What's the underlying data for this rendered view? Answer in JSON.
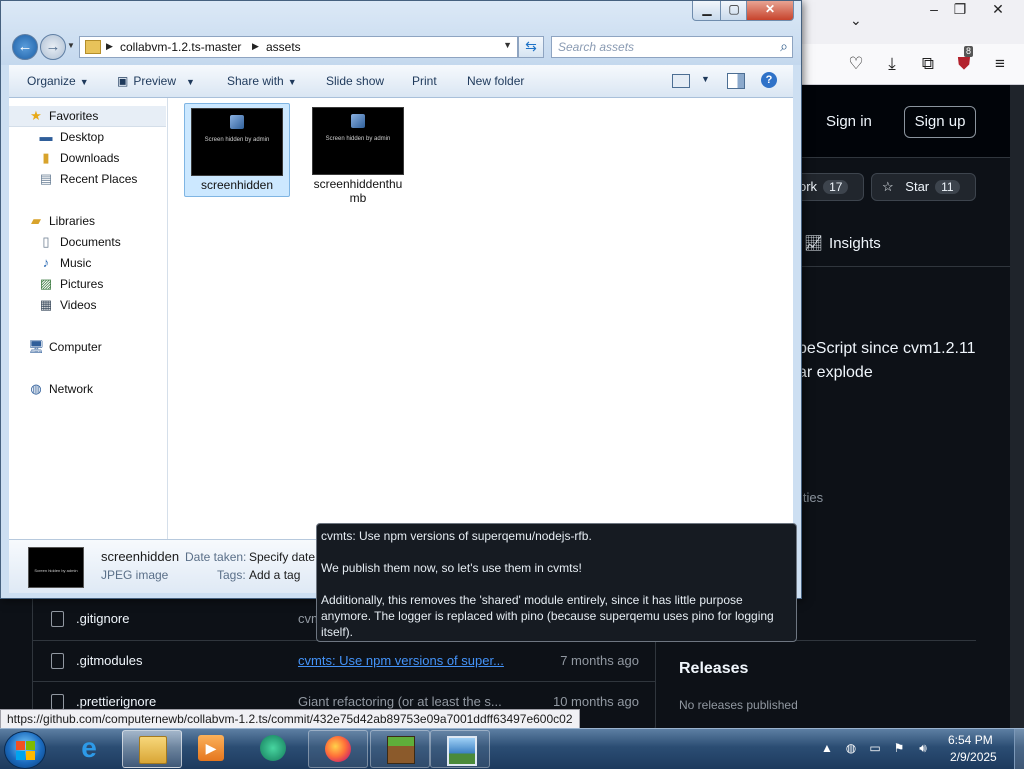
{
  "browser": {
    "header": {
      "sign_in": "Sign in",
      "sign_up": "Sign up"
    },
    "repo_actions": {
      "fork_label": "Fork",
      "fork_visible": "ork",
      "fork_count": "17",
      "star_label": "Star",
      "star_count": "11"
    },
    "tabs": {
      "insights": "Insights"
    },
    "about": {
      "line1": "peScript since cvm1.2.11",
      "line2": "ar explode",
      "activity": "ities"
    },
    "files": [
      {
        "name": ".gitignore",
        "message": "cvm",
        "date": "",
        "message_link": false
      },
      {
        "name": ".gitmodules",
        "message": "cvmts: Use npm versions of super...",
        "date": "7 months ago",
        "message_link": true
      },
      {
        "name": ".prettierignore",
        "message": "Giant refactoring (or at least the s...",
        "date": "10 months ago",
        "message_link": false
      }
    ],
    "releases": {
      "title": "Releases",
      "empty": "No releases published"
    },
    "status_url": "https://github.com/computernewb/collabvm-1.2.ts/commit/432e75d42ab89753e09a7001ddff63497e600c02",
    "extension_badge": "8"
  },
  "explorer": {
    "address": {
      "segments": [
        "collabvm-1.2.ts-master",
        "assets"
      ]
    },
    "search": {
      "placeholder": "Search assets"
    },
    "commands": {
      "organize": "Organize",
      "preview": "Preview",
      "share_with": "Share with",
      "slide_show": "Slide show",
      "print": "Print",
      "new_folder": "New folder"
    },
    "nav": {
      "favorites": "Favorites",
      "desktop": "Desktop",
      "downloads": "Downloads",
      "recent_places": "Recent Places",
      "libraries": "Libraries",
      "documents": "Documents",
      "music": "Music",
      "pictures": "Pictures",
      "videos": "Videos",
      "computer": "Computer",
      "network": "Network"
    },
    "files": [
      {
        "name": "screenhidden",
        "thumb_text": "Screen hidden by admin",
        "selected": true
      },
      {
        "name": "screenhiddenthumb",
        "thumb_text": "Screen hidden by admin",
        "selected": false
      }
    ],
    "details": {
      "name": "screenhidden",
      "type": "JPEG image",
      "date_taken_label": "Date taken:",
      "date_taken_value": "Specify date t",
      "tags_label": "Tags:",
      "tags_value": "Add a tag"
    }
  },
  "tooltip": {
    "line1": "cvmts: Use npm versions of superqemu/nodejs-rfb.",
    "line2": "We publish them now, so let's use them in cvmts!",
    "line3": "Additionally, this removes the 'shared' module entirely, since it has little purpose anymore. The logger is replaced with pino (because superqemu uses pino for logging itself)."
  },
  "taskbar": {
    "apps": [
      "internet-explorer",
      "windows-explorer",
      "media-player",
      "unknown-app",
      "firefox",
      "minecraft",
      "picture-viewer"
    ],
    "clock_time": "6:54 PM",
    "clock_date": "2/9/2025"
  },
  "colors": {
    "github_bg": "#0d1117",
    "link_blue": "#4493f8",
    "explorer_frame": "#cddff2",
    "taskbar": "#2b4d73"
  }
}
